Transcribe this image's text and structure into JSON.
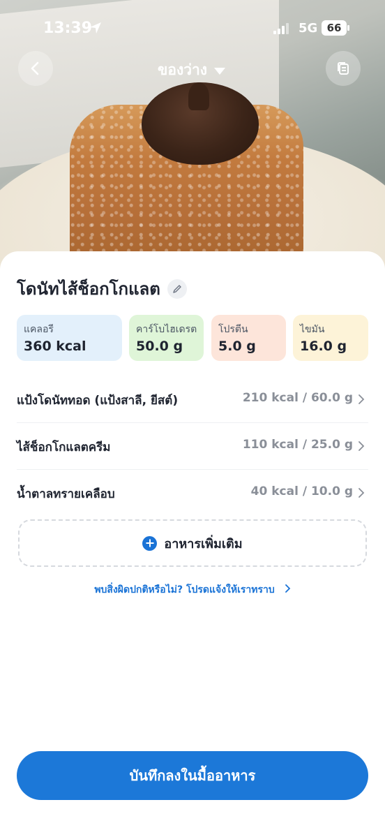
{
  "status_bar": {
    "time": "13:39",
    "network": "5G",
    "battery": "66"
  },
  "header": {
    "meal_type": "ของว่าง"
  },
  "food": {
    "title": "โดนัทไส้ช็อกโกแลต"
  },
  "nutrition": {
    "calories": {
      "label": "แคลอรี",
      "value": "360 kcal"
    },
    "carbs": {
      "label": "คาร์โบไฮเดรต",
      "value": "50.0 g"
    },
    "protein": {
      "label": "โปรตีน",
      "value": "5.0 g"
    },
    "fat": {
      "label": "ไขมัน",
      "value": "16.0 g"
    }
  },
  "ingredients": [
    {
      "name": "แป้งโดนัททอด (แป้งสาลี, ยีสต์)",
      "amount": "210 kcal / 60.0 g"
    },
    {
      "name": "ไส้ช็อกโกแลตครีม",
      "amount": "110 kcal / 25.0 g"
    },
    {
      "name": "น้ำตาลทรายเคลือบ",
      "amount": "40 kcal / 10.0 g"
    }
  ],
  "add_more_label": "อาหารเพิ่มเติม",
  "report_link": "พบสิ่งผิดปกติหรือไม่? โปรดแจ้งให้เราทราบ",
  "save_button": "บันทึกลงในมื้ออาหาร",
  "colors": {
    "primary": "#1c78d8",
    "calories_bg": "#e3f0fb",
    "carbs_bg": "#dff5d8",
    "protein_bg": "#fde5da",
    "fat_bg": "#fdf3d8"
  }
}
